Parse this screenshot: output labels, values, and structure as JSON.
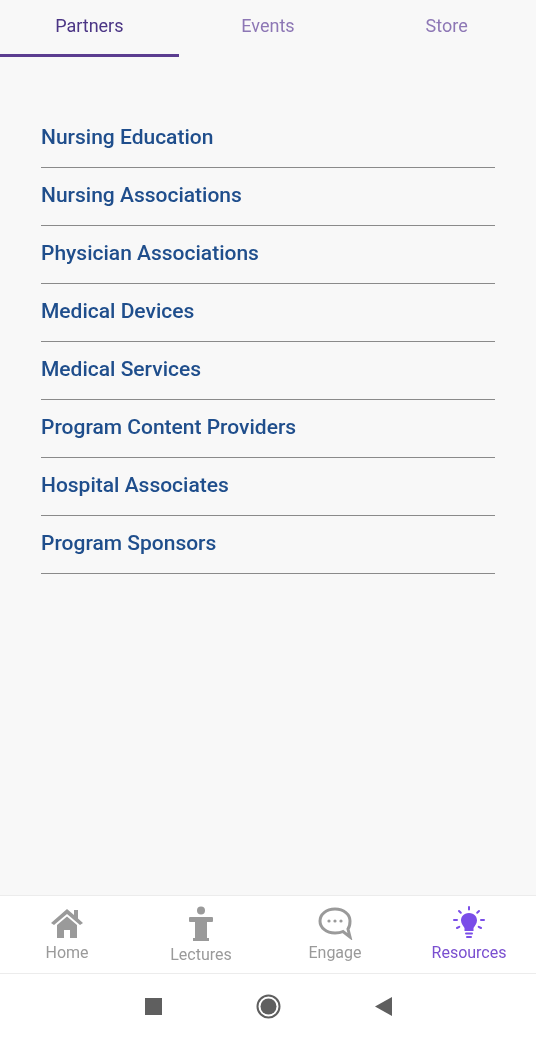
{
  "tabs": [
    {
      "label": "Partners",
      "selected": true
    },
    {
      "label": "Events",
      "selected": false
    },
    {
      "label": "Store",
      "selected": false
    }
  ],
  "categories": [
    "Nursing Education",
    "Nursing Associations",
    "Physician Associations",
    "Medical Devices",
    "Medical Services",
    "Program Content Providers",
    "Hospital Associates",
    "Program Sponsors"
  ],
  "bottom_nav": [
    {
      "kind": "home",
      "label": "Home",
      "selected": false
    },
    {
      "kind": "lectures",
      "label": "Lectures",
      "selected": false
    },
    {
      "kind": "engage",
      "label": "Engage",
      "selected": false
    },
    {
      "kind": "resources",
      "label": "Resources",
      "selected": true
    }
  ]
}
